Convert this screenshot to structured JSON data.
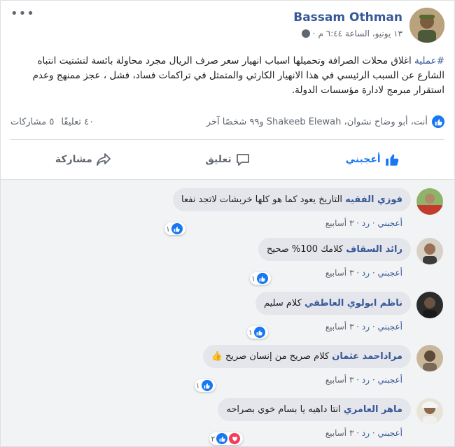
{
  "post": {
    "author": "Bassam Othman",
    "date": "١٣ يونيو، الساعة ٦:٤٤ م",
    "dot": "·",
    "hashtag": "#عملية",
    "text": " اغلاق محلات الصرافة وتحميلها اسباب انهيار سعر صرف الريال مجرد محاولة بائسة لتشتيت انتباه الشارع عن السبب الرئيسي في هذا الانهيار الكارثي والمتمثل في تراكمات فساد، فشل ، عجز ممنهج وعدم استقرار مبرمج لادارة مؤسسات الدولة."
  },
  "summary": {
    "likers": "أنت، أبو وضاح نشوان، Shakeeb Elewah و٩٩ شخصًا آخر",
    "comments": "٤٠ تعليقًا",
    "shares": "٥ مشاركات"
  },
  "actions": {
    "like": "أعجبني",
    "comment": "تعليق",
    "share": "مشاركة"
  },
  "comments": [
    {
      "name": "فوزي الفقيه",
      "text": "التاريخ يعود كما هو كلها خربشات لاتجد نفعا",
      "like": "أعجبني",
      "reply": "رد",
      "time": "٣ أسابيع",
      "react_count": "١"
    },
    {
      "name": "رائد السقاف",
      "text": "كلامك 100% صحيح",
      "like": "أعجبني",
      "reply": "رد",
      "time": "٣ أسابيع",
      "react_count": "١"
    },
    {
      "name": "ناظم ابولوي العاطفي",
      "text": "كلام سليم",
      "like": "أعجبني",
      "reply": "رد",
      "time": "٣ أسابيع",
      "react_count": "١"
    },
    {
      "name": "مراداحمد عثمان",
      "text": "كلام صريح من إنسان صريح 👍",
      "like": "أعجبني",
      "reply": "رد",
      "time": "٣ أسابيع",
      "react_count": "١"
    },
    {
      "name": "ماهر العامري",
      "text": "انتا داهيه يا بسام خوي بصراحه",
      "like": "أعجبني",
      "reply": "رد",
      "time": "٣ أسابيع",
      "react_count": "٢"
    }
  ],
  "sep": "·",
  "colors": {
    "link": "#385898",
    "accent": "#1877f2",
    "love": "#f33e58"
  }
}
